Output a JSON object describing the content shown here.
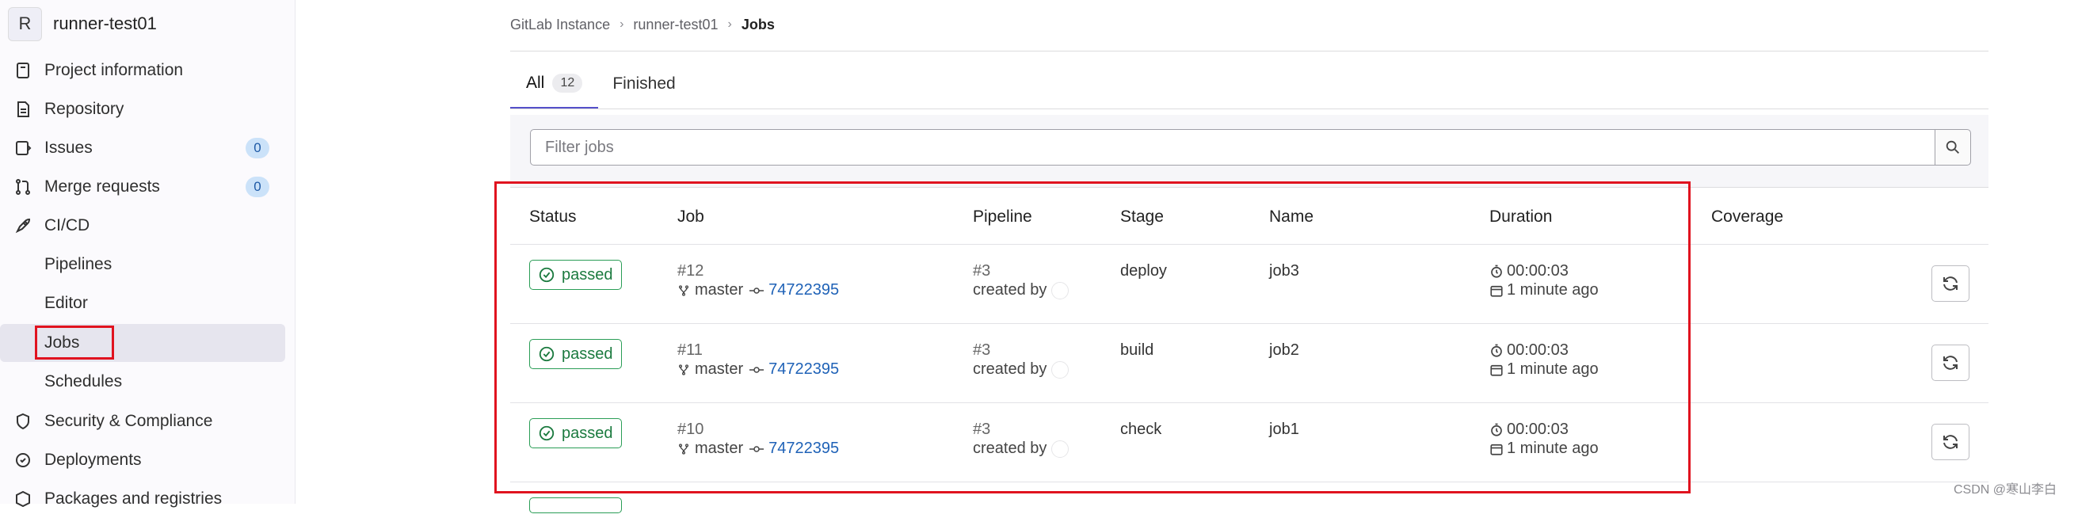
{
  "project": {
    "avatar_letter": "R",
    "name": "runner-test01"
  },
  "sidebar": {
    "items": [
      {
        "label": "Project information",
        "icon": "project-info-icon"
      },
      {
        "label": "Repository",
        "icon": "repository-icon"
      },
      {
        "label": "Issues",
        "icon": "issues-icon",
        "badge": "0"
      },
      {
        "label": "Merge requests",
        "icon": "merge-request-icon",
        "badge": "0"
      },
      {
        "label": "CI/CD",
        "icon": "rocket-icon"
      },
      {
        "label": "Security & Compliance",
        "icon": "shield-icon"
      },
      {
        "label": "Deployments",
        "icon": "deployments-icon"
      },
      {
        "label": "Packages and registries",
        "icon": "package-icon"
      }
    ],
    "cicd_sub": [
      "Pipelines",
      "Editor",
      "Jobs",
      "Schedules"
    ]
  },
  "breadcrumb": [
    "GitLab Instance",
    "runner-test01",
    "Jobs"
  ],
  "tabs": [
    {
      "label": "All",
      "count": "12"
    },
    {
      "label": "Finished"
    }
  ],
  "filter": {
    "placeholder": "Filter jobs"
  },
  "table": {
    "headers": [
      "Status",
      "Job",
      "Pipeline",
      "Stage",
      "Name",
      "Duration",
      "Coverage"
    ],
    "rows": [
      {
        "status": "passed",
        "job_id": "#12",
        "branch": "master",
        "sha": "74722395",
        "pipeline": "#3",
        "created_by": "created by",
        "stage": "deploy",
        "name": "job3",
        "duration": "00:00:03",
        "finished": "1 minute ago"
      },
      {
        "status": "passed",
        "job_id": "#11",
        "branch": "master",
        "sha": "74722395",
        "pipeline": "#3",
        "created_by": "created by",
        "stage": "build",
        "name": "job2",
        "duration": "00:00:03",
        "finished": "1 minute ago"
      },
      {
        "status": "passed",
        "job_id": "#10",
        "branch": "master",
        "sha": "74722395",
        "pipeline": "#3",
        "created_by": "created by",
        "stage": "check",
        "name": "job1",
        "duration": "00:00:03",
        "finished": "1 minute ago"
      }
    ]
  },
  "watermark": "CSDN @寒山李白",
  "colors": {
    "accent": "#5450c9",
    "success": "#1b7a3f",
    "link": "#1f62b7",
    "highlight": "#e0131f"
  }
}
